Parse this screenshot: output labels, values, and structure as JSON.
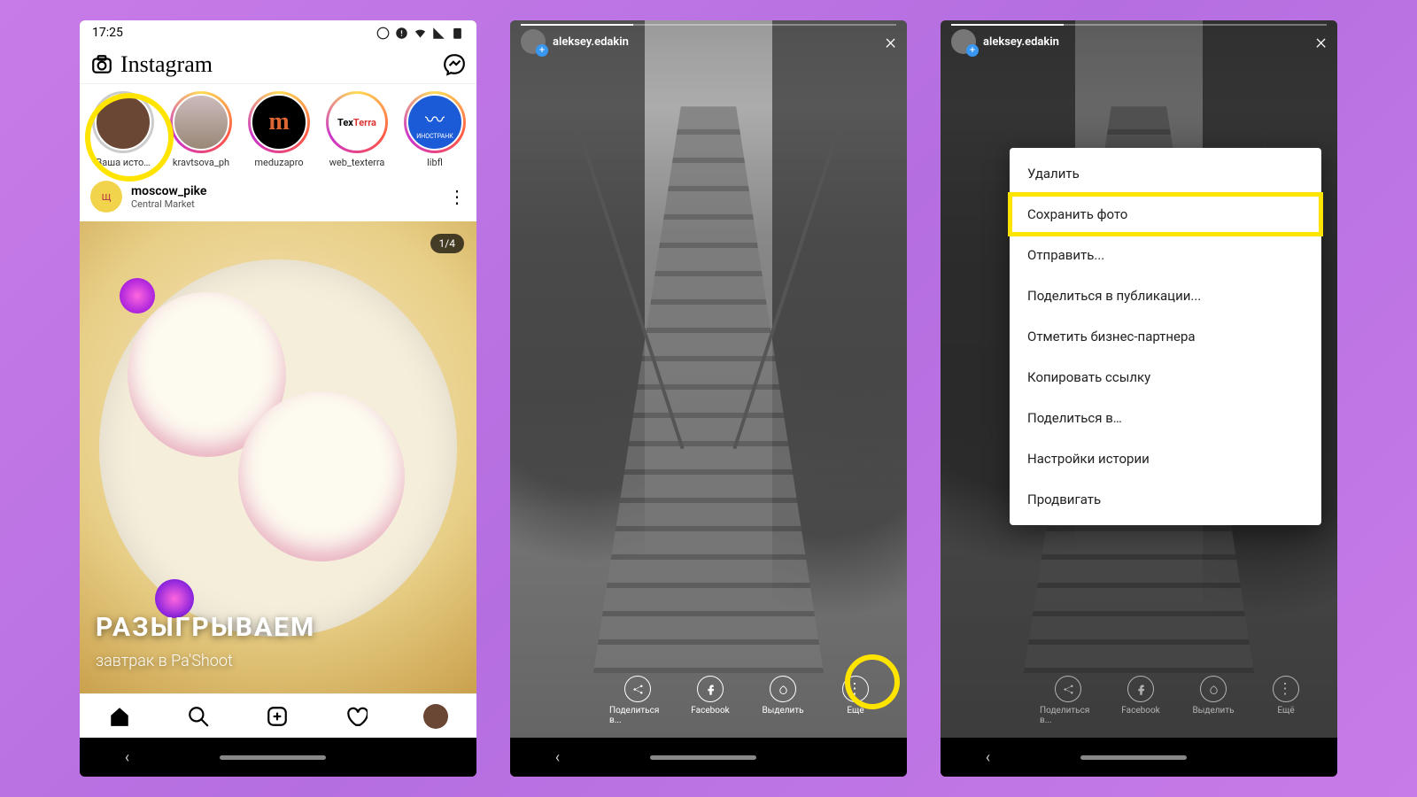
{
  "status": {
    "time": "17:25"
  },
  "header": {
    "logo": "Instagram"
  },
  "stories": [
    {
      "name": "Ваша исто…",
      "ring": "seen",
      "bg": "#6a4634"
    },
    {
      "name": "kravtsova_ph",
      "ring": "gradient",
      "bg": "#a98"
    },
    {
      "name": "meduzapro",
      "ring": "gradient",
      "bg": "#000",
      "letter": "m",
      "lettercolor": "#d63"
    },
    {
      "name": "web_texterra",
      "ring": "gradient",
      "bg": "#fff",
      "label": "TexTerra"
    },
    {
      "name": "libfl",
      "ring": "gradient",
      "bg": "#1b5bd8",
      "label": "~ ИНОСТРАНК"
    }
  ],
  "post": {
    "avatar_letter": "щ",
    "username": "moscow_pike",
    "location": "Central Market",
    "counter": "1/4",
    "caption1": "РАЗЫГРЫВАЕМ",
    "caption2": "завтрак в Pa'Shoot"
  },
  "story_user": "aleksey.edakin",
  "story_actions": {
    "share": "Поделиться в...",
    "facebook": "Facebook",
    "highlight": "Выделить",
    "more": "Ещё"
  },
  "menu": [
    "Удалить",
    "Сохранить фото",
    "Отправить...",
    "Поделиться в публикации...",
    "Отметить бизнес-партнера",
    "Копировать ссылку",
    "Поделиться в…",
    "Настройки истории",
    "Продвигать"
  ],
  "menu_highlight_index": 1
}
